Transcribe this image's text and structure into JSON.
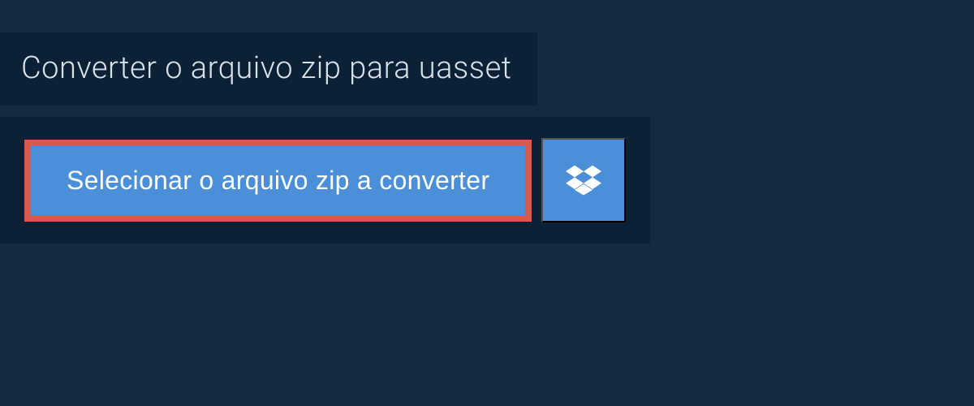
{
  "header": {
    "title": "Converter o arquivo zip para uasset"
  },
  "actions": {
    "select_file_label": "Selecionar o arquivo zip a converter",
    "dropbox_icon": "dropbox-icon"
  },
  "colors": {
    "background": "#15293f",
    "panel": "#0d2136",
    "button_primary": "#4a8fd8",
    "highlight_border": "#d85a4f"
  }
}
